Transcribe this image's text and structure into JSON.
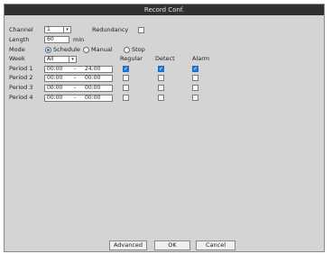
{
  "dialog": {
    "title": "Record Conf."
  },
  "labels": {
    "channel": "Channel",
    "redundancy": "Redundancy",
    "length": "Length",
    "min": "min",
    "mode": "Mode",
    "week": "Week"
  },
  "channel": {
    "value": "1"
  },
  "length": {
    "value": "60"
  },
  "mode": {
    "options": [
      "Schedule",
      "Manual",
      "Stop"
    ],
    "selected": "Schedule"
  },
  "week": {
    "value": "All"
  },
  "columns": {
    "regular": "Regular",
    "detect": "Detect",
    "alarm": "Alarm"
  },
  "periods": [
    {
      "label": "Period 1",
      "start": "00:00",
      "sep": "-",
      "end": "24:00",
      "regular": true,
      "detect": true,
      "alarm": true
    },
    {
      "label": "Period 2",
      "start": "00:00",
      "sep": "-",
      "end": "00:00",
      "regular": false,
      "detect": false,
      "alarm": false
    },
    {
      "label": "Period 3",
      "start": "00:00",
      "sep": "-",
      "end": "00:00",
      "regular": false,
      "detect": false,
      "alarm": false
    },
    {
      "label": "Period 4",
      "start": "00:00",
      "sep": "-",
      "end": "00:00",
      "regular": false,
      "detect": false,
      "alarm": false
    }
  ],
  "buttons": {
    "advanced": "Advanced",
    "ok": "OK",
    "cancel": "Cancel"
  },
  "icons": {
    "dropdown": "chevron-down-icon",
    "check": "check-icon"
  },
  "colors": {
    "titlebar": "#303030",
    "panel": "#d4d4d4",
    "accent": "#1f7cd6"
  }
}
